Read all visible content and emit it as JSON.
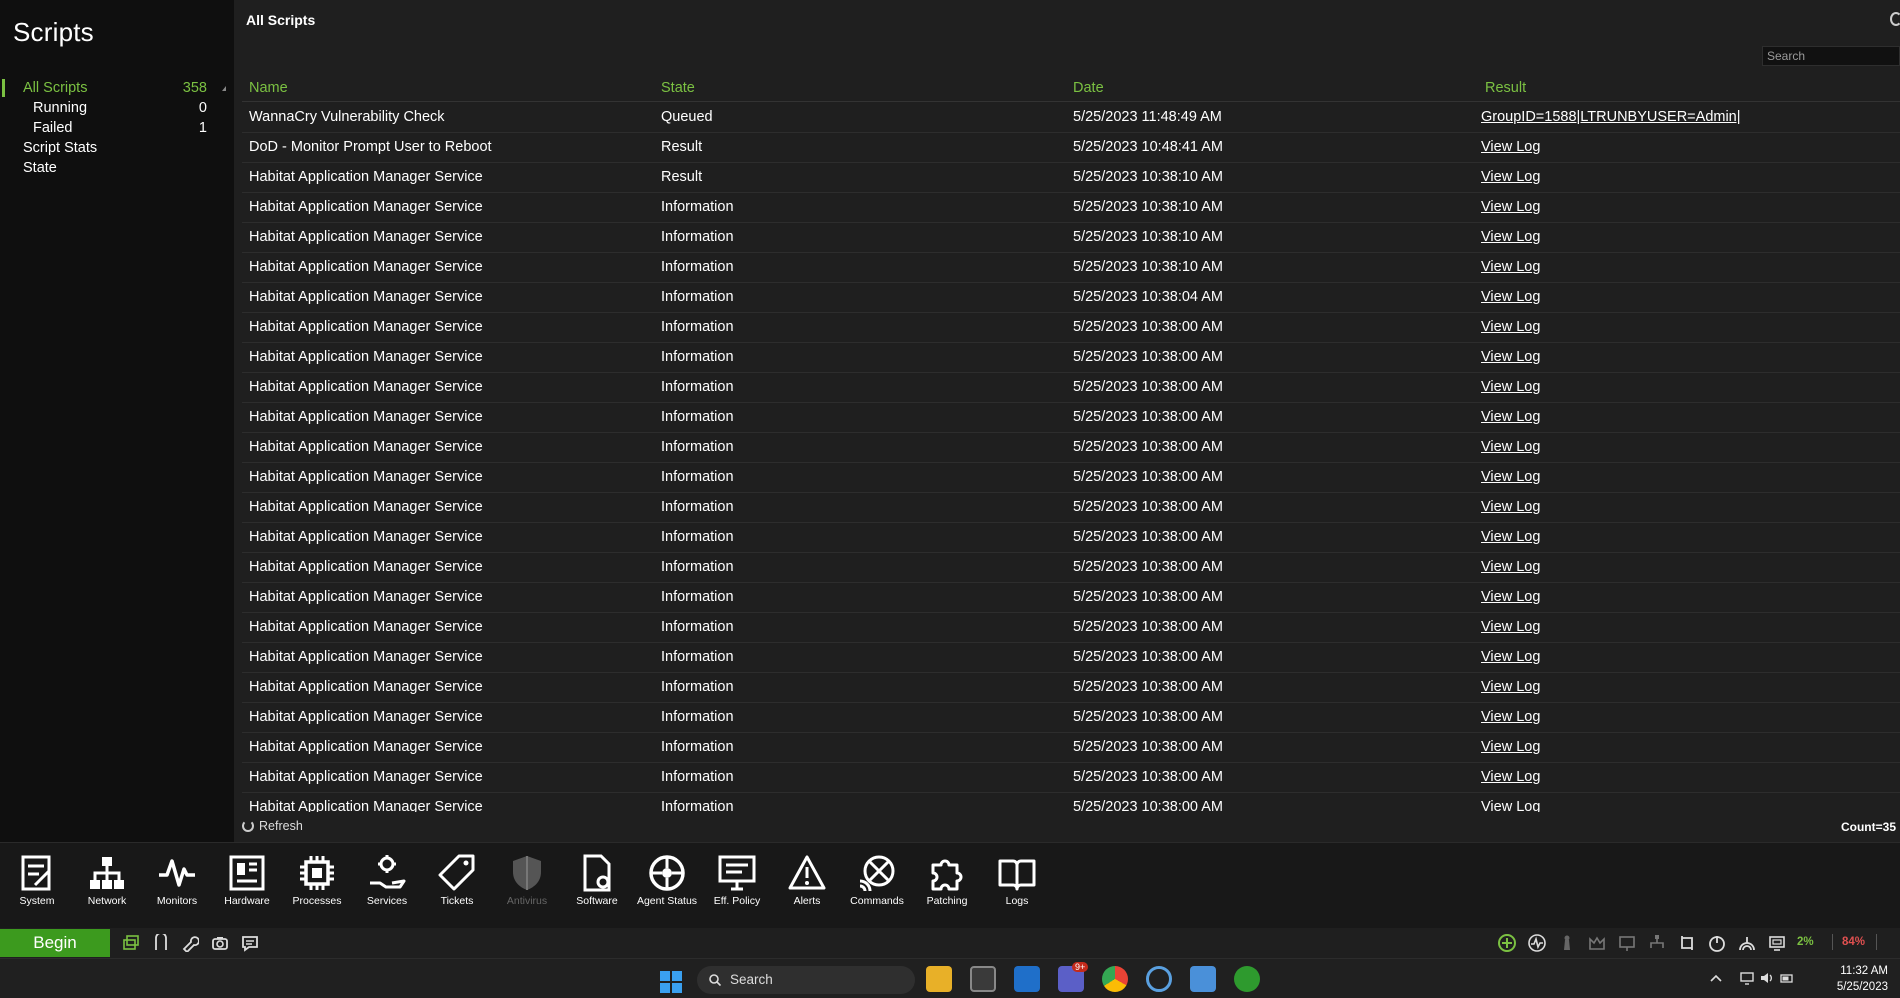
{
  "sidebar": {
    "title": "Scripts",
    "items": [
      {
        "label": "All Scripts",
        "count": "358"
      },
      {
        "label": "Running",
        "count": "0"
      },
      {
        "label": "Failed",
        "count": "1"
      },
      {
        "label": "Script Stats",
        "count": ""
      },
      {
        "label": "State",
        "count": ""
      }
    ]
  },
  "main": {
    "heading": "All Scripts",
    "search_placeholder": "Search",
    "columns": [
      "Name",
      "State",
      "Date",
      "Result"
    ],
    "rows": [
      {
        "name": "WannaCry Vulnerability Check",
        "state": "Queued",
        "date": "5/25/2023 11:48:49 AM",
        "result": "GroupID=1588|LTRUNBYUSER=Admin|"
      },
      {
        "name": "DoD - Monitor Prompt User to Reboot",
        "state": "Result",
        "date": "5/25/2023 10:48:41 AM",
        "result": "View Log"
      },
      {
        "name": "Habitat Application Manager Service",
        "state": "Result",
        "date": "5/25/2023 10:38:10 AM",
        "result": "View Log"
      },
      {
        "name": "Habitat Application Manager Service",
        "state": "Information",
        "date": "5/25/2023 10:38:10 AM",
        "result": "View Log"
      },
      {
        "name": "Habitat Application Manager Service",
        "state": "Information",
        "date": "5/25/2023 10:38:10 AM",
        "result": "View Log"
      },
      {
        "name": "Habitat Application Manager Service",
        "state": "Information",
        "date": "5/25/2023 10:38:10 AM",
        "result": "View Log"
      },
      {
        "name": "Habitat Application Manager Service",
        "state": "Information",
        "date": "5/25/2023 10:38:04 AM",
        "result": "View Log"
      },
      {
        "name": "Habitat Application Manager Service",
        "state": "Information",
        "date": "5/25/2023 10:38:00 AM",
        "result": "View Log"
      },
      {
        "name": "Habitat Application Manager Service",
        "state": "Information",
        "date": "5/25/2023 10:38:00 AM",
        "result": "View Log"
      },
      {
        "name": "Habitat Application Manager Service",
        "state": "Information",
        "date": "5/25/2023 10:38:00 AM",
        "result": "View Log"
      },
      {
        "name": "Habitat Application Manager Service",
        "state": "Information",
        "date": "5/25/2023 10:38:00 AM",
        "result": "View Log"
      },
      {
        "name": "Habitat Application Manager Service",
        "state": "Information",
        "date": "5/25/2023 10:38:00 AM",
        "result": "View Log"
      },
      {
        "name": "Habitat Application Manager Service",
        "state": "Information",
        "date": "5/25/2023 10:38:00 AM",
        "result": "View Log"
      },
      {
        "name": "Habitat Application Manager Service",
        "state": "Information",
        "date": "5/25/2023 10:38:00 AM",
        "result": "View Log"
      },
      {
        "name": "Habitat Application Manager Service",
        "state": "Information",
        "date": "5/25/2023 10:38:00 AM",
        "result": "View Log"
      },
      {
        "name": "Habitat Application Manager Service",
        "state": "Information",
        "date": "5/25/2023 10:38:00 AM",
        "result": "View Log"
      },
      {
        "name": "Habitat Application Manager Service",
        "state": "Information",
        "date": "5/25/2023 10:38:00 AM",
        "result": "View Log"
      },
      {
        "name": "Habitat Application Manager Service",
        "state": "Information",
        "date": "5/25/2023 10:38:00 AM",
        "result": "View Log"
      },
      {
        "name": "Habitat Application Manager Service",
        "state": "Information",
        "date": "5/25/2023 10:38:00 AM",
        "result": "View Log"
      },
      {
        "name": "Habitat Application Manager Service",
        "state": "Information",
        "date": "5/25/2023 10:38:00 AM",
        "result": "View Log"
      },
      {
        "name": "Habitat Application Manager Service",
        "state": "Information",
        "date": "5/25/2023 10:38:00 AM",
        "result": "View Log"
      },
      {
        "name": "Habitat Application Manager Service",
        "state": "Information",
        "date": "5/25/2023 10:38:00 AM",
        "result": "View Log"
      },
      {
        "name": "Habitat Application Manager Service",
        "state": "Information",
        "date": "5/25/2023 10:38:00 AM",
        "result": "View Log"
      },
      {
        "name": "Habitat Application Manager Service",
        "state": "Information",
        "date": "5/25/2023 10:38:00 AM",
        "result": "View Log"
      }
    ],
    "refresh_label": "Refresh",
    "count_label": "Count=35"
  },
  "toolbar": {
    "items": [
      {
        "label": "System",
        "icon": "system-icon"
      },
      {
        "label": "Network",
        "icon": "network-icon"
      },
      {
        "label": "Monitors",
        "icon": "monitors-icon"
      },
      {
        "label": "Hardware",
        "icon": "hardware-icon"
      },
      {
        "label": "Processes",
        "icon": "processes-icon"
      },
      {
        "label": "Services",
        "icon": "services-icon"
      },
      {
        "label": "Tickets",
        "icon": "tickets-icon"
      },
      {
        "label": "Antivirus",
        "icon": "antivirus-icon"
      },
      {
        "label": "Software",
        "icon": "software-icon"
      },
      {
        "label": "Agent Status",
        "icon": "agent-status-icon"
      },
      {
        "label": "Eff. Policy",
        "icon": "eff-policy-icon"
      },
      {
        "label": "Alerts",
        "icon": "alerts-icon"
      },
      {
        "label": "Commands",
        "icon": "commands-icon"
      },
      {
        "label": "Patching",
        "icon": "patching-icon"
      },
      {
        "label": "Logs",
        "icon": "logs-icon"
      }
    ]
  },
  "statusbar": {
    "begin_label": "Begin",
    "cpu": "2%",
    "mem": "84%",
    "colors": {
      "green": "#3c9a1e",
      "accent": "#7bc142",
      "red": "#e05050"
    }
  },
  "taskbar": {
    "search_label": "Search",
    "time": "11:32 AM",
    "date": "5/25/2023",
    "badge": "9+"
  }
}
